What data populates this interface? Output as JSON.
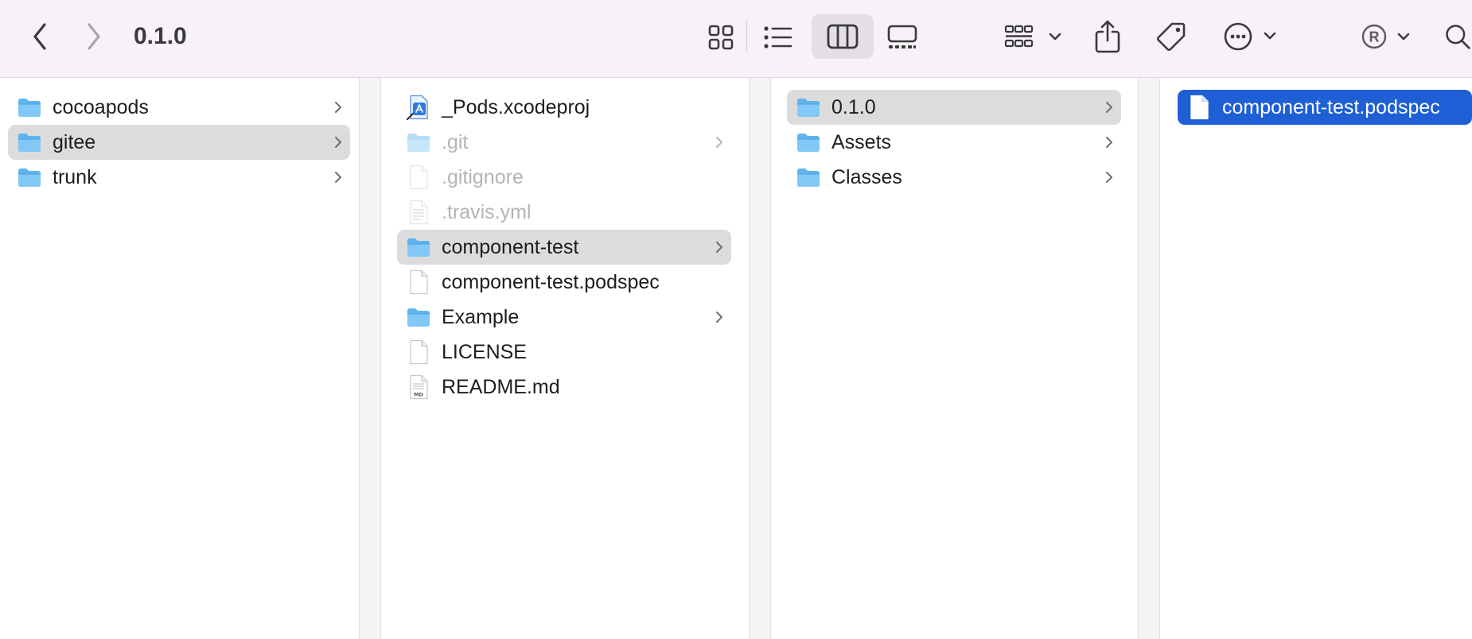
{
  "toolbar": {
    "path_title": "0.1.0",
    "icons": [
      "chevron-left-icon",
      "chevron-right-icon",
      "grid-view-icon",
      "list-view-icon",
      "column-view-icon",
      "gallery-view-icon",
      "group-icon",
      "share-icon",
      "tag-icon",
      "more-icon",
      "account-icon",
      "search-icon"
    ]
  },
  "columns": [
    {
      "items": [
        {
          "label": "cocoapods",
          "type": "folder",
          "has_children": true
        },
        {
          "label": "gitee",
          "type": "folder",
          "has_children": true,
          "state": "selected"
        },
        {
          "label": "trunk",
          "type": "folder",
          "has_children": true
        }
      ]
    },
    {
      "items": [
        {
          "label": "_Pods.xcodeproj",
          "type": "xcodeproj",
          "has_children": false
        },
        {
          "label": ".git",
          "type": "folder",
          "has_children": true,
          "dim": true
        },
        {
          "label": ".gitignore",
          "type": "file",
          "has_children": false,
          "dim": true
        },
        {
          "label": ".travis.yml",
          "type": "textfile",
          "has_children": false,
          "dim": true
        },
        {
          "label": "component-test",
          "type": "folder",
          "has_children": true,
          "state": "selected"
        },
        {
          "label": "component-test.podspec",
          "type": "file",
          "has_children": false
        },
        {
          "label": "Example",
          "type": "folder",
          "has_children": true
        },
        {
          "label": "LICENSE",
          "type": "file",
          "has_children": false
        },
        {
          "label": "README.md",
          "type": "markdown",
          "has_children": false
        }
      ]
    },
    {
      "items": [
        {
          "label": "0.1.0",
          "type": "folder",
          "has_children": true,
          "state": "selected"
        },
        {
          "label": "Assets",
          "type": "folder",
          "has_children": true
        },
        {
          "label": "Classes",
          "type": "folder",
          "has_children": true
        }
      ]
    },
    {
      "items": [
        {
          "label": "component-test.podspec",
          "type": "file",
          "has_children": false,
          "state": "active"
        }
      ]
    }
  ],
  "colors": {
    "toolbar_bg": "#f7f2f7",
    "selection_gray": "#dcdcdc",
    "selection_blue": "#1e5fd6",
    "folder_blue": "#5fb4ee"
  }
}
